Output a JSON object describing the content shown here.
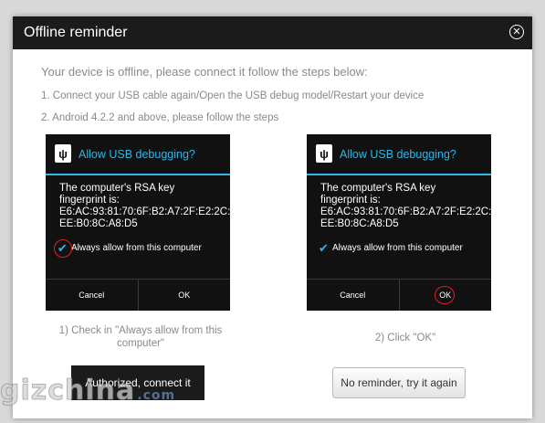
{
  "dialog": {
    "title": "Offline reminder",
    "close_icon": "close-circle-icon",
    "intro": "Your device is offline, please connect it follow the steps below:",
    "step1": "1. Connect your USB cable again/Open the USB debug model/Restart your device",
    "step2": "2. Android 4.2.2 and above, please follow the steps"
  },
  "phone_prompt": {
    "title": "Allow USB debugging?",
    "body_line1": "The computer's RSA key",
    "body_line2": "fingerprint is:",
    "body_line3": "E6:AC:93:81:70:6F:B2:A7:2F:E2:2C:",
    "body_line4": "EE:B0:8C:A8:D5",
    "checkbox_label": "Always allow from this computer",
    "cancel_label": "Cancel",
    "ok_label": "OK",
    "icon": "usb-icon"
  },
  "captions": {
    "left": "1) Check in \"Always allow from this computer\"",
    "right": "2) Click \"OK\""
  },
  "buttons": {
    "authorized": "Authorized, connect it",
    "no_reminder": "No reminder, try it again"
  },
  "watermark": {
    "main": "gizchina",
    "suffix": ".com"
  },
  "colors": {
    "accent": "#33b5e5",
    "highlight": "#e02020",
    "titlebar": "#1b1b1b"
  }
}
